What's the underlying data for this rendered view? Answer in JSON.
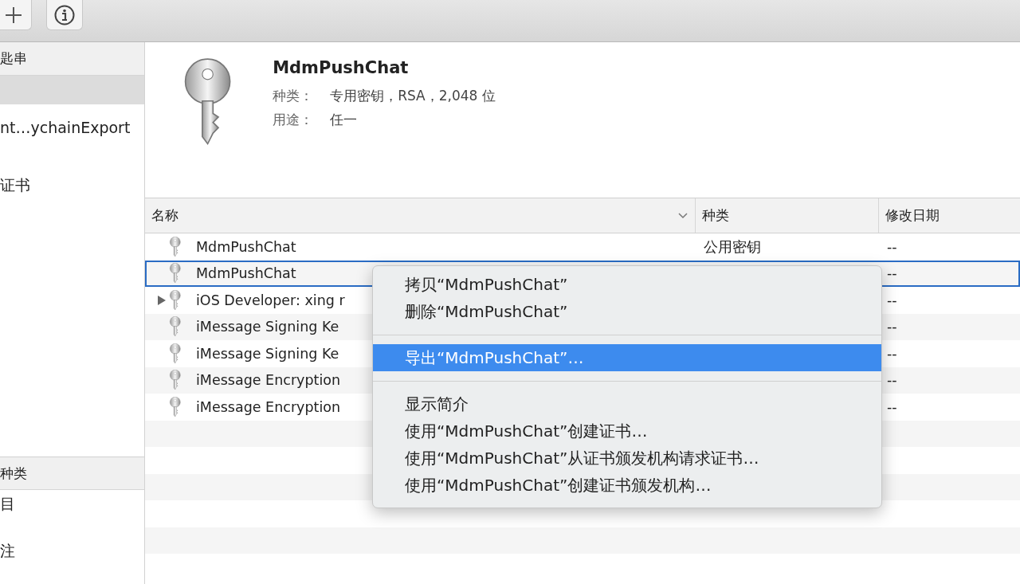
{
  "sidebar": {
    "keychains_header": "匙串",
    "keychains": [
      {
        "selected": true
      },
      {
        "label": "nt…ychainExport",
        "selected": false
      },
      {
        "label": "证书",
        "selected": false
      }
    ],
    "category_header": "种类",
    "categories": [
      {
        "label": "目",
        "selected": false
      },
      {
        "label": "注",
        "selected": false
      }
    ]
  },
  "detail": {
    "title": "MdmPushChat",
    "fields": [
      {
        "label": "种类：",
        "value": "专用密钥，RSA，2,048 位"
      },
      {
        "label": "用途：",
        "value": "任一"
      }
    ]
  },
  "table": {
    "columns": [
      "名称",
      "种类",
      "修改日期"
    ],
    "rows": [
      {
        "name": "MdmPushChat",
        "kind": "公用密钥",
        "date": "--",
        "selected": false,
        "expandable": false
      },
      {
        "name": "MdmPushChat",
        "date": "--",
        "selected": true,
        "expandable": false
      },
      {
        "name": "iOS Developer: xing r",
        "date": "--",
        "selected": false,
        "expandable": true
      },
      {
        "name": "iMessage Signing Ke",
        "date": "--",
        "selected": false,
        "expandable": false
      },
      {
        "name": "iMessage Signing Ke",
        "date": "--",
        "selected": false,
        "expandable": false
      },
      {
        "name": "iMessage Encryption",
        "date": "--",
        "selected": false,
        "expandable": false
      },
      {
        "name": "iMessage Encryption",
        "date": "--",
        "selected": false,
        "expandable": false
      }
    ]
  },
  "context_menu": {
    "items": [
      {
        "kind": "item",
        "label": "拷贝“MdmPushChat”",
        "selected": false
      },
      {
        "kind": "item",
        "label": "删除“MdmPushChat”",
        "selected": false
      },
      {
        "kind": "separator"
      },
      {
        "kind": "item",
        "label": "导出“MdmPushChat”…",
        "selected": true
      },
      {
        "kind": "separator"
      },
      {
        "kind": "item",
        "label": "显示简介",
        "selected": false
      },
      {
        "kind": "item",
        "label": "使用“MdmPushChat”创建证书…",
        "selected": false
      },
      {
        "kind": "item",
        "label": "使用“MdmPushChat”从证书颁发机构请求证书…",
        "selected": false
      },
      {
        "kind": "item",
        "label": "使用“MdmPushChat”创建证书颁发机构…",
        "selected": false
      }
    ]
  }
}
